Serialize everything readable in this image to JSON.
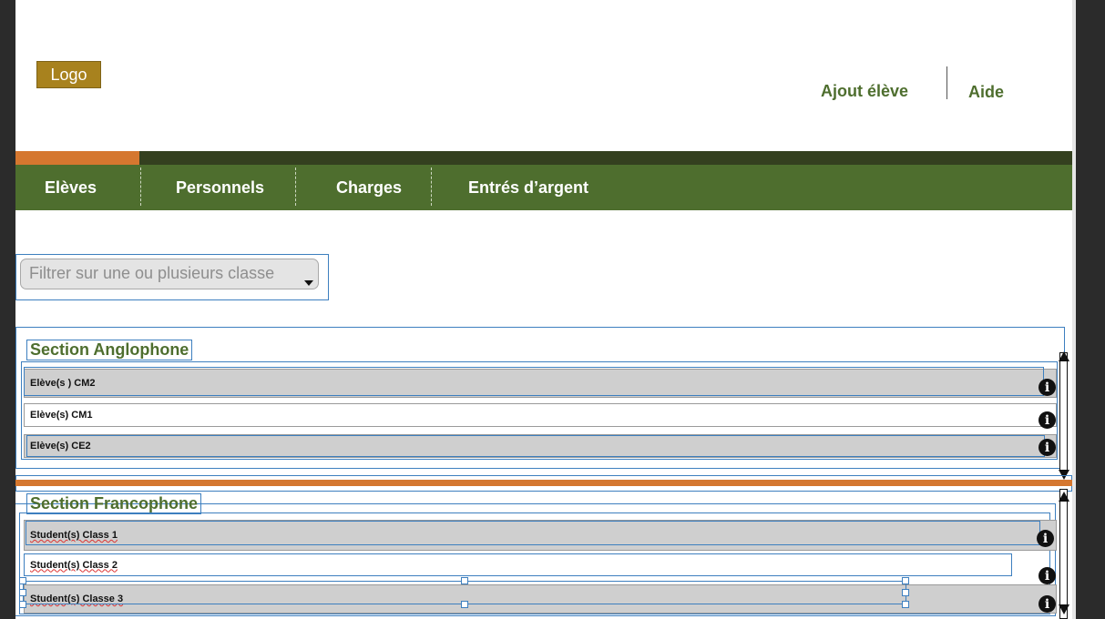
{
  "header": {
    "logo": "Logo",
    "add_student": "Ajout élève",
    "help": "Aide"
  },
  "nav": {
    "tabs": [
      {
        "label": "Elèves"
      },
      {
        "label": "Personnels"
      },
      {
        "label": "Charges"
      },
      {
        "label": "Entrés d’argent"
      }
    ]
  },
  "filter": {
    "placeholder": "Filtrer sur une ou plusieurs classe"
  },
  "sections": [
    {
      "title": "Section Anglophone",
      "rows": [
        "Elève(s ) CM2",
        "Elève(s) CM1",
        "Elève(s) CE2"
      ]
    },
    {
      "title": "Section Francophone",
      "rows": [
        "Student(s) Class 1",
        "Student(s) Class 2",
        "Student(s) Classe 3"
      ]
    }
  ],
  "colors": {
    "nav_green": "#4e6e2e",
    "accent_orange": "#d5772f",
    "logo_gold": "#a8821e"
  },
  "icons": [
    "info-icon",
    "chevron-down-icon",
    "scroll-up-icon",
    "scroll-down-icon"
  ]
}
